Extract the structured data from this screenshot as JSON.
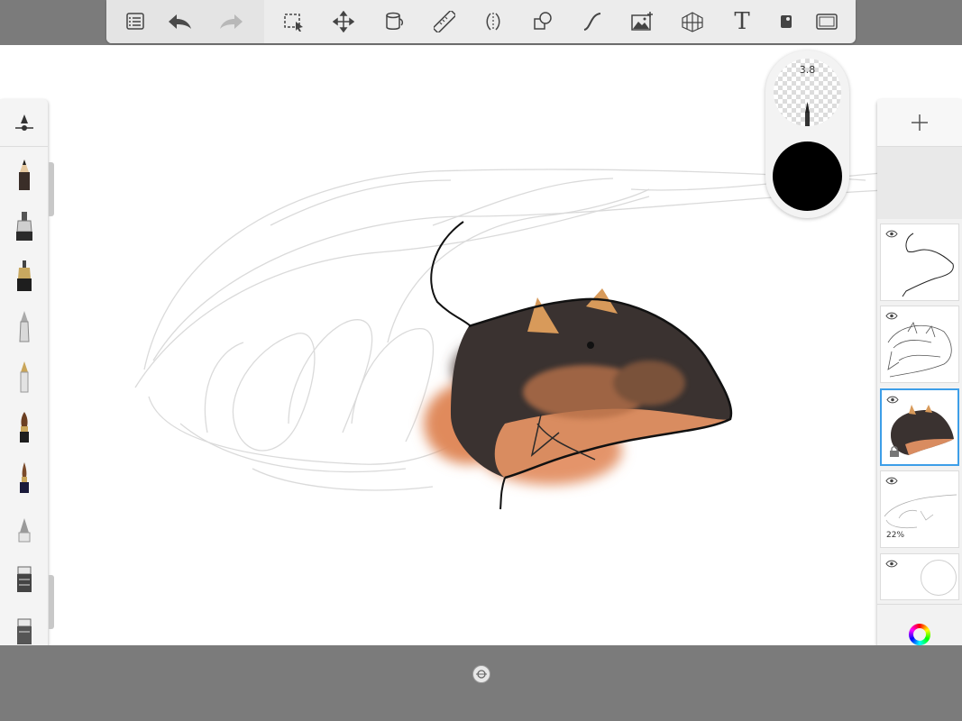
{
  "toolbar": {
    "items": [
      {
        "name": "list-icon"
      },
      {
        "name": "undo-icon"
      },
      {
        "name": "redo-icon"
      },
      {
        "name": "selection-icon"
      },
      {
        "name": "transform-icon"
      },
      {
        "name": "fill-bucket-icon"
      },
      {
        "name": "ruler-icon"
      },
      {
        "name": "symmetry-icon"
      },
      {
        "name": "shapes-icon"
      },
      {
        "name": "curve-icon"
      },
      {
        "name": "image-add-icon"
      },
      {
        "name": "perspective-grid-icon"
      },
      {
        "name": "text-icon"
      },
      {
        "name": "stencil-icon"
      },
      {
        "name": "fullscreen-icon"
      }
    ],
    "text_label": "T"
  },
  "brushes": [
    {
      "name": "pencil-brush-icon"
    },
    {
      "name": "marker-brush-icon"
    },
    {
      "name": "technical-pen-brush-icon"
    },
    {
      "name": "airbrush-brush-icon"
    },
    {
      "name": "ballpoint-pen-brush-icon"
    },
    {
      "name": "paintbrush-brush-icon"
    },
    {
      "name": "fine-paintbrush-brush-icon"
    },
    {
      "name": "soft-eraser-brush-icon"
    },
    {
      "name": "chisel-marker-brush-icon"
    },
    {
      "name": "flat-marker-brush-icon"
    }
  ],
  "brush_puck": {
    "size": "3.8",
    "color": "#000000"
  },
  "layers": [
    {
      "name": "layer-outline",
      "selected": false,
      "opacity": ""
    },
    {
      "name": "layer-sketch",
      "selected": false,
      "opacity": ""
    },
    {
      "name": "layer-color",
      "selected": true,
      "opacity": ""
    },
    {
      "name": "layer-rough-sketch",
      "selected": false,
      "opacity": "22%"
    },
    {
      "name": "layer-background",
      "selected": false,
      "opacity": ""
    }
  ],
  "colors": {
    "selection": "#3d9ee8",
    "toolbar_bg": "#ececec",
    "chrome_bg": "#7b7b7b"
  }
}
